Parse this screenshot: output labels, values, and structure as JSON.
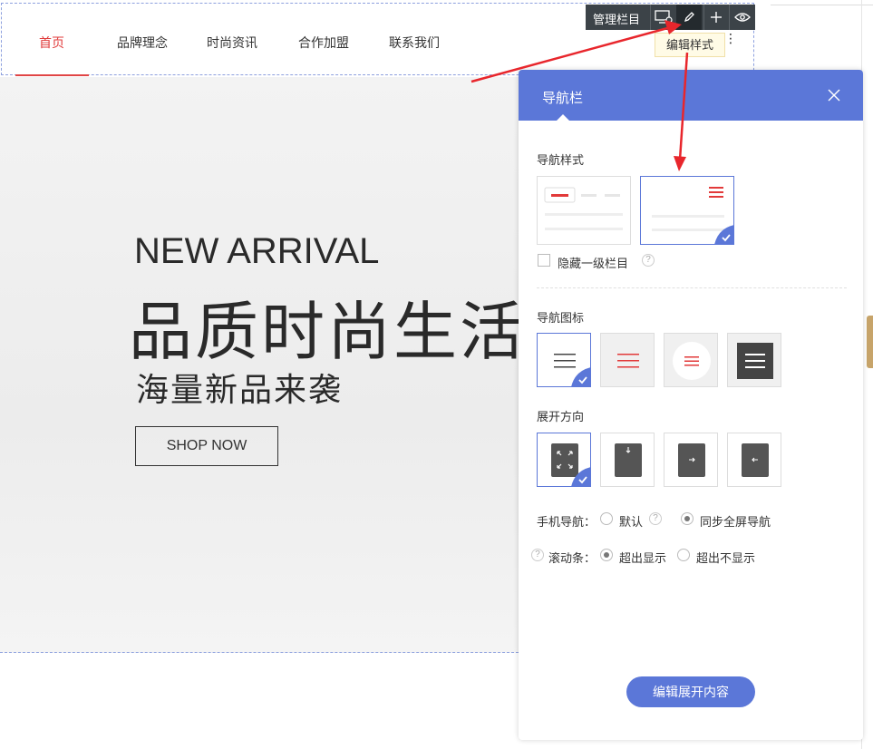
{
  "nav": {
    "items": [
      "首页",
      "品牌理念",
      "时尚资讯",
      "合作加盟",
      "联系我们"
    ],
    "active_index": 0
  },
  "hero": {
    "title_en": "NEW ARRIVAL",
    "title_cn": "品质时尚生活",
    "subtitle": "海量新品来袭",
    "button": "SHOP NOW"
  },
  "toolbar": {
    "manage_label": "管理栏目",
    "icons": [
      "screen-settings-icon",
      "pencil-icon",
      "plus-icon",
      "eye-icon"
    ],
    "tooltip": "编辑样式"
  },
  "panel": {
    "title": "导航栏",
    "nav_style": {
      "label": "导航样式",
      "selected_index": 1,
      "hide_first_level_label": "隐藏一级栏目",
      "hide_first_level_checked": false
    },
    "nav_icon": {
      "label": "导航图标",
      "selected_index": 0,
      "options": [
        "hamburger-plain-icon",
        "hamburger-red-icon",
        "hamburger-red-circle-icon",
        "hamburger-dark-box-icon"
      ]
    },
    "expand_direction": {
      "label": "展开方向",
      "selected_index": 0,
      "options": [
        "expand-fullscreen-icon",
        "arrow-down-icon",
        "arrow-right-icon",
        "arrow-left-icon"
      ]
    },
    "mobile_nav": {
      "label": "手机导航：",
      "options": [
        "默认",
        "同步全屏导航"
      ],
      "selected_index": 1
    },
    "scrollbar": {
      "label": "滚动条：",
      "options": [
        "超出显示",
        "超出不显示"
      ],
      "selected_index": 0
    },
    "edit_expand_button": "编辑展开内容"
  },
  "colors": {
    "accent": "#5b77d8",
    "nav_active": "#e03a3a",
    "arrow": "#e8262c",
    "toolbar_bg": "#3c4348"
  }
}
